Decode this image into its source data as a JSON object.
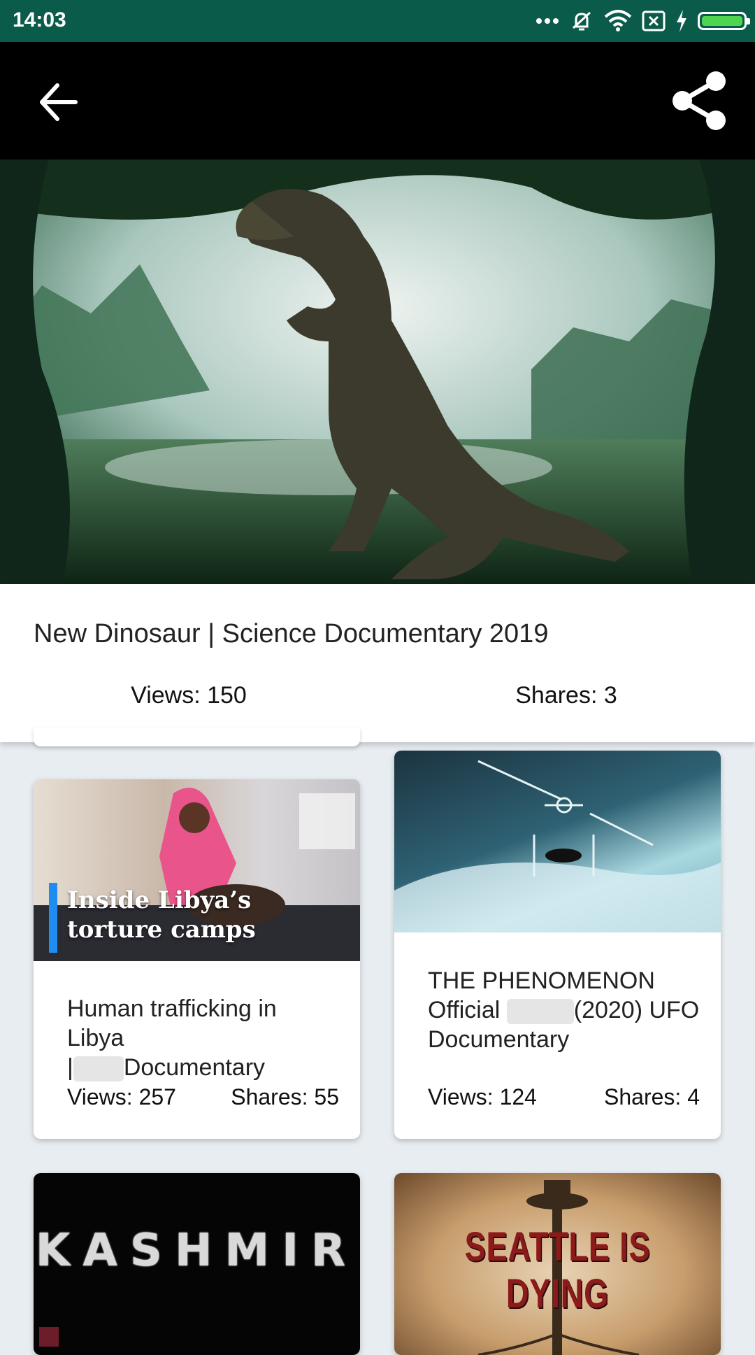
{
  "status_bar": {
    "time": "14:03",
    "icons": [
      "more-icon",
      "mute-icon",
      "wifi-icon",
      "sim-icon",
      "charging-icon",
      "battery-icon"
    ],
    "battery_color": "#4ed44e",
    "background": "#0b5b4b"
  },
  "app_bar": {
    "back_icon": "arrow-back-icon",
    "share_icon": "share-icon"
  },
  "hero": {
    "image": "dinosaur-jungle-thumbnail"
  },
  "video": {
    "title": "New Dinosaur | Science Documentary 2019",
    "views": "Views: 150",
    "shares": "Shares: 3"
  },
  "cards": [
    {
      "thumb_caption_line1": "Inside Libya’s",
      "thumb_caption_line2": "torture camps",
      "title_line1": "Human trafficking in Libya",
      "title_line2_prefix": "|",
      "title_line2_suffix": "Documentary",
      "views": "Views: 257",
      "shares": "Shares: 55"
    },
    {
      "title_line1": "THE PHENOMENON",
      "title_line2_prefix": "Official",
      "title_line2_suffix": "(2020) UFO",
      "title_line3": "Documentary",
      "views": "Views: 124",
      "shares": "Shares: 4"
    },
    {
      "thumb_text": "KASHMIR"
    },
    {
      "thumb_text": "SEATTLE IS DYING"
    }
  ]
}
